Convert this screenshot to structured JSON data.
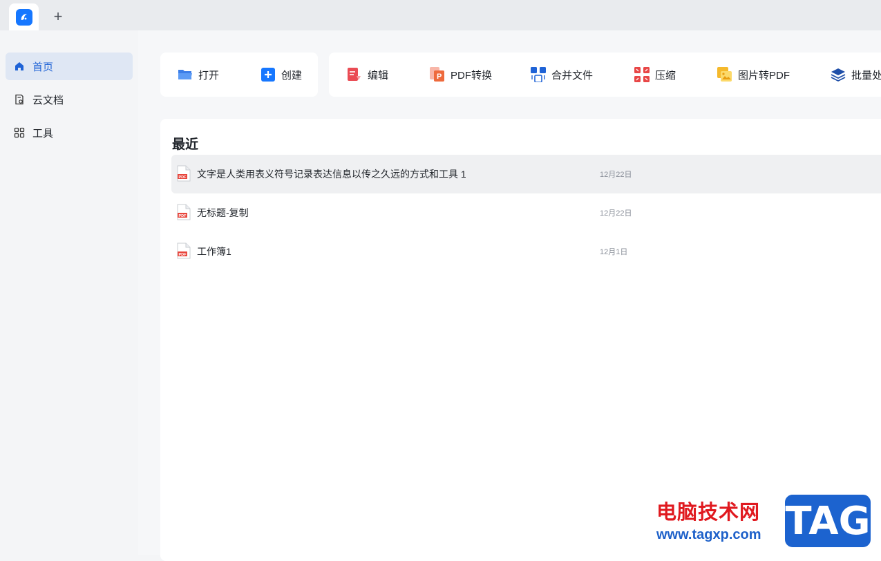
{
  "titlebar": {
    "app_icon": "app-logo-icon",
    "new_tab_label": "+"
  },
  "sidebar": {
    "items": [
      {
        "label": "首页",
        "icon": "home-icon",
        "active": true
      },
      {
        "label": "云文档",
        "icon": "cloud-document-icon",
        "active": false
      },
      {
        "label": "工具",
        "icon": "grid-tools-icon",
        "active": false
      }
    ]
  },
  "toolbar": {
    "open": "打开",
    "create": "创建",
    "edit": "编辑",
    "pdf_convert": "PDF转换",
    "merge": "合并文件",
    "compress": "压缩",
    "image_to_pdf": "图片转PDF",
    "batch": "批量处"
  },
  "recent": {
    "title": "最近",
    "files": [
      {
        "name": "文字是人类用表义符号记录表达信息以传之久远的方式和工具 1",
        "date": "12月22日",
        "icon_label": "PDF"
      },
      {
        "name": "无标题-复制",
        "date": "12月22日",
        "icon_label": "PDF"
      },
      {
        "name": "工作簿1",
        "date": "12月1日",
        "icon_label": "PDF"
      }
    ]
  },
  "watermark": {
    "site_name": "电脑技术网",
    "url": "www.tagxp.com",
    "tag": "TAG"
  },
  "colors": {
    "accent": "#1677ff",
    "active_bg": "#dfe7f4",
    "pdf_red": "#e8453c",
    "watermark_red": "#e0191f",
    "watermark_blue": "#1c63cf"
  }
}
